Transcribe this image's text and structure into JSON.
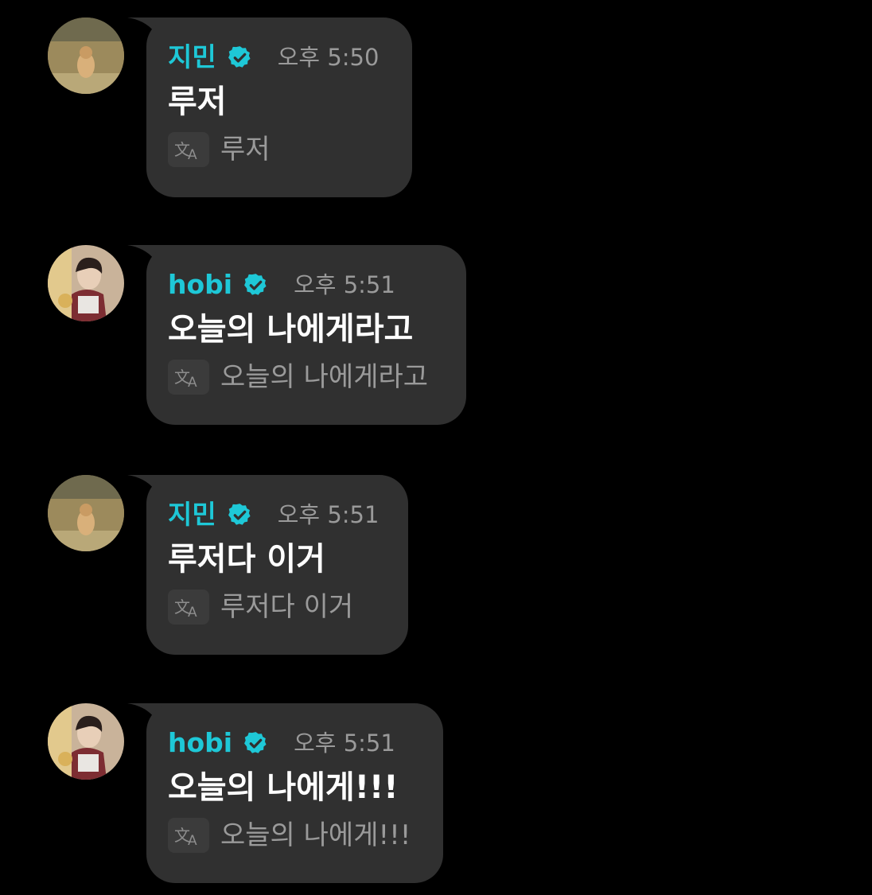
{
  "messages": [
    {
      "author": "지민",
      "time": "오후 5:50",
      "text": "루저",
      "translation": "루저",
      "avatar": "jimin-avatar",
      "verified_icon": "verified-badge-icon",
      "translate_icon": "translate-icon"
    },
    {
      "author": "hobi",
      "time": "오후 5:51",
      "text": "오늘의 나에게라고",
      "translation": "오늘의 나에게라고",
      "avatar": "hobi-avatar",
      "verified_icon": "verified-badge-icon",
      "translate_icon": "translate-icon"
    },
    {
      "author": "지민",
      "time": "오후 5:51",
      "text": "루저다 이거",
      "translation": "루저다 이거",
      "avatar": "jimin-avatar",
      "verified_icon": "verified-badge-icon",
      "translate_icon": "translate-icon"
    },
    {
      "author": "hobi",
      "time": "오후 5:51",
      "text": "오늘의 나에게!!!",
      "translation": "오늘의 나에게!!!",
      "avatar": "hobi-avatar",
      "verified_icon": "verified-badge-icon",
      "translate_icon": "translate-icon"
    }
  ],
  "colors": {
    "background": "#000000",
    "bubble": "#303030",
    "author_name": "#1ec8d7",
    "timestamp": "#9a9a9a",
    "message_text": "#ffffff",
    "translation_text": "#9a9a9a"
  }
}
